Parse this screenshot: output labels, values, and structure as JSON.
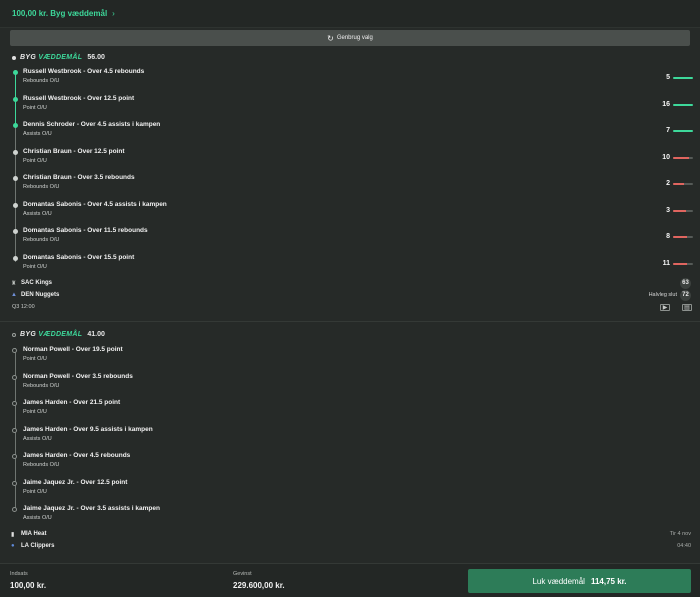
{
  "header": {
    "title": "100,00 kr.  Byg væddemål",
    "chevron": "›"
  },
  "reuse_button": {
    "icon": "refresh-icon",
    "label": "Genbrug valg"
  },
  "bet1": {
    "logo_a": "BYG ",
    "logo_b": "VÆDDEMÅL",
    "odds": "56.00",
    "legs": [
      {
        "name": "Russell Westbrook - Over 4.5 rebounds",
        "market": "Rebounds O/U",
        "value": "5",
        "status": "won",
        "progress": 1.0
      },
      {
        "name": "Russell Westbrook - Over 12.5 point",
        "market": "Point O/U",
        "value": "16",
        "status": "won",
        "progress": 1.0
      },
      {
        "name": "Dennis Schroder - Over 4.5 assists i kampen",
        "market": "Assists O/U",
        "value": "7",
        "status": "won",
        "progress": 1.0
      },
      {
        "name": "Christian Braun - Over 12.5 point",
        "market": "Point O/U",
        "value": "10",
        "status": "pending",
        "progress": 0.8
      },
      {
        "name": "Christian Braun - Over 3.5 rebounds",
        "market": "Rebounds O/U",
        "value": "2",
        "status": "pending",
        "progress": 0.57
      },
      {
        "name": "Domantas Sabonis - Over 4.5 assists i kampen",
        "market": "Assists O/U",
        "value": "3",
        "status": "pending",
        "progress": 0.67
      },
      {
        "name": "Domantas Sabonis - Over 11.5 rebounds",
        "market": "Rebounds O/U",
        "value": "8",
        "status": "pending",
        "progress": 0.7
      },
      {
        "name": "Domantas Sabonis - Over 15.5 point",
        "market": "Point O/U",
        "value": "11",
        "status": "pending",
        "progress": 0.71
      }
    ],
    "team1": {
      "name": "SAC Kings",
      "score": "63"
    },
    "team2": {
      "name": "DEN Nuggets",
      "score": "72",
      "status": "Halvleg slut"
    },
    "clock": "Q3  12:00"
  },
  "bet2": {
    "logo_a": "BYG ",
    "logo_b": "VÆDDEMÅL",
    "odds": "41.00",
    "legs": [
      {
        "name": "Norman Powell - Over 19.5 point",
        "market": "Point O/U"
      },
      {
        "name": "Norman Powell - Over 3.5 rebounds",
        "market": "Rebounds O/U"
      },
      {
        "name": "James Harden - Over 21.5 point",
        "market": "Point O/U"
      },
      {
        "name": "James Harden - Over 9.5 assists i kampen",
        "market": "Assists O/U"
      },
      {
        "name": "James Harden - Over 4.5 rebounds",
        "market": "Rebounds O/U"
      },
      {
        "name": "Jaime Jaquez Jr. - Over 12.5 point",
        "market": "Point O/U"
      },
      {
        "name": "Jaime Jaquez Jr. - Over 3.5 assists i kampen",
        "market": "Assists O/U"
      }
    ],
    "team1": {
      "name": "MIA Heat",
      "date": "Tir 4 nov"
    },
    "team2": {
      "name": "LA Clippers",
      "time": "04:40"
    }
  },
  "footer": {
    "stake_label": "Indsats",
    "stake_value": "100,00 kr.",
    "win_label": "Gevinst",
    "win_value": "229.600,00 kr.",
    "cta_label": "Luk væddemål",
    "cta_odds": "114,75 kr."
  },
  "colors": {
    "accent": "#3dd89a",
    "danger": "#e0655f",
    "cta": "#2d7c58"
  }
}
